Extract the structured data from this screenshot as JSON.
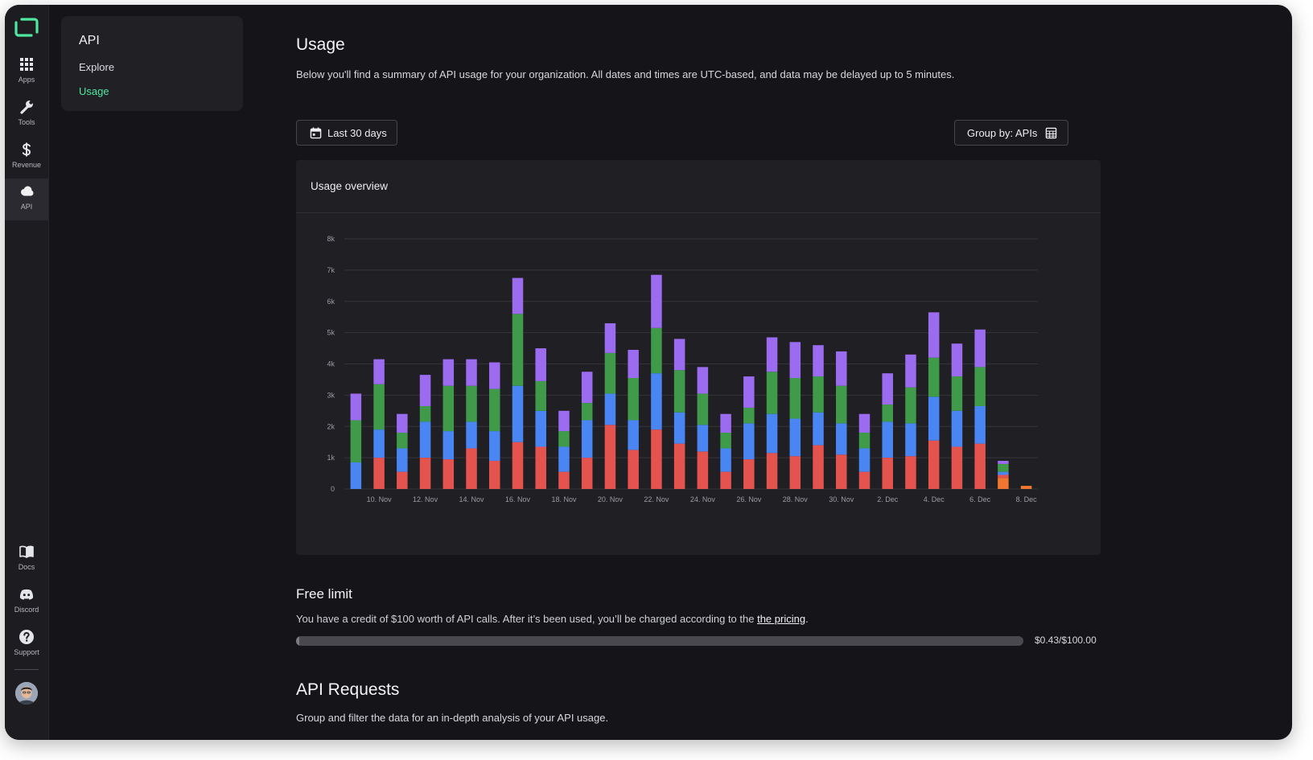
{
  "rail": {
    "items": [
      {
        "label": "Apps",
        "icon": "apps-grid-icon"
      },
      {
        "label": "Tools",
        "icon": "wrench-icon"
      },
      {
        "label": "Revenue",
        "icon": "dollar-icon"
      },
      {
        "label": "API",
        "icon": "cloud-icon"
      }
    ],
    "bottom": [
      {
        "label": "Docs",
        "icon": "book-icon"
      },
      {
        "label": "Discord",
        "icon": "discord-icon"
      },
      {
        "label": "Support",
        "icon": "question-icon"
      }
    ]
  },
  "subnav": {
    "title": "API",
    "links": [
      "Explore",
      "Usage"
    ]
  },
  "page": {
    "title": "Usage",
    "description": "Below you'll find a summary of API usage for your organization. All dates and times are UTC-based, and data may be delayed up to 5 minutes.",
    "date_button": "Last 30 days",
    "group_button": "Group by: APIs"
  },
  "card": {
    "title": "Usage overview"
  },
  "colors": {
    "blue": "#4a85f4",
    "red": "#e5534f",
    "green": "#3f9a4a",
    "purple": "#9b6bf0",
    "orange": "#f0772f",
    "accent": "#4ee8a0"
  },
  "chart_data": {
    "type": "bar",
    "stacked": true,
    "ylim": [
      0,
      8000
    ],
    "yticks": [
      "0",
      "1k",
      "2k",
      "3k",
      "4k",
      "5k",
      "6k",
      "7k",
      "8k"
    ],
    "xticks": [
      "10. Nov",
      "12. Nov",
      "14. Nov",
      "16. Nov",
      "18. Nov",
      "20. Nov",
      "22. Nov",
      "24. Nov",
      "26. Nov",
      "28. Nov",
      "30. Nov",
      "2. Dec",
      "4. Dec",
      "6. Dec",
      "8. Dec"
    ],
    "categories": [
      "9. Nov",
      "10. Nov",
      "11. Nov",
      "12. Nov",
      "13. Nov",
      "14. Nov",
      "15. Nov",
      "16. Nov",
      "17. Nov",
      "18. Nov",
      "19. Nov",
      "20. Nov",
      "21. Nov",
      "22. Nov",
      "23. Nov",
      "24. Nov",
      "25. Nov",
      "26. Nov",
      "27. Nov",
      "28. Nov",
      "29. Nov",
      "30. Nov",
      "1. Dec",
      "2. Dec",
      "3. Dec",
      "4. Dec",
      "5. Dec",
      "6. Dec",
      "7. Dec",
      "8. Dec"
    ],
    "grid": true,
    "legend": "none",
    "series": [
      {
        "color": "#f0772f",
        "values": [
          0,
          0,
          0,
          0,
          0,
          0,
          0,
          0,
          0,
          0,
          0,
          0,
          0,
          0,
          0,
          0,
          0,
          0,
          0,
          0,
          0,
          0,
          0,
          0,
          0,
          0,
          0,
          0,
          350,
          100
        ]
      },
      {
        "color": "#e5534f",
        "values": [
          0,
          1000,
          550,
          1000,
          950,
          1300,
          900,
          1500,
          1350,
          550,
          1000,
          2050,
          1250,
          1900,
          1450,
          1200,
          550,
          950,
          1150,
          1050,
          1400,
          1100,
          550,
          1000,
          1050,
          1550,
          1350,
          1450,
          100
        ]
      },
      {
        "color": "#4a85f4",
        "values": [
          850,
          900,
          750,
          1150,
          900,
          850,
          950,
          1800,
          1150,
          800,
          1200,
          1000,
          950,
          1800,
          1000,
          850,
          750,
          1150,
          1250,
          1200,
          1050,
          1000,
          750,
          1150,
          1050,
          1400,
          1150,
          1200,
          100
        ]
      },
      {
        "color": "#3f9a4a",
        "values": [
          1350,
          1450,
          500,
          500,
          1450,
          1150,
          1350,
          2300,
          950,
          500,
          550,
          1300,
          1350,
          1450,
          1350,
          1000,
          500,
          500,
          1350,
          1300,
          1150,
          1200,
          500,
          550,
          1150,
          1250,
          1100,
          1250,
          250
        ]
      },
      {
        "color": "#9b6bf0",
        "values": [
          850,
          800,
          600,
          1000,
          850,
          850,
          850,
          1150,
          1050,
          650,
          1000,
          950,
          900,
          1700,
          1000,
          850,
          600,
          1000,
          1100,
          1150,
          1000,
          1100,
          600,
          1000,
          1050,
          1450,
          1050,
          1200,
          100
        ]
      }
    ]
  },
  "free_limit": {
    "title": "Free limit",
    "text": "You have a credit of $100 worth of API calls. After it’s been used, you’ll be charged according to the ",
    "link": "the pricing",
    "text_end": ".",
    "used": 0.43,
    "total": 100,
    "label": "$0.43/$100.00"
  },
  "api_requests": {
    "title": "API Requests",
    "description": "Group and filter the data for an in-depth analysis of your API usage."
  }
}
